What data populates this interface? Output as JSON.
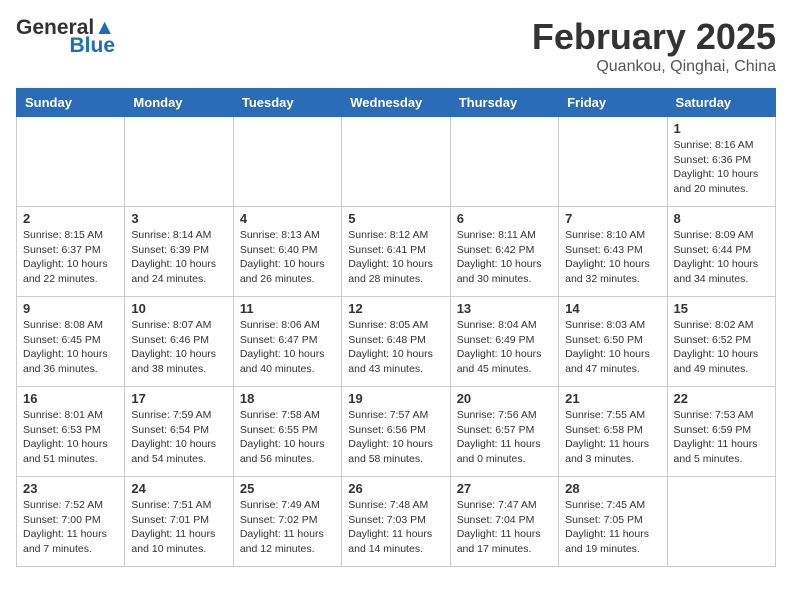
{
  "header": {
    "logo_general": "General",
    "logo_blue": "Blue",
    "month_year": "February 2025",
    "location": "Quankou, Qinghai, China"
  },
  "weekdays": [
    "Sunday",
    "Monday",
    "Tuesday",
    "Wednesday",
    "Thursday",
    "Friday",
    "Saturday"
  ],
  "weeks": [
    [
      {
        "day": "",
        "info": ""
      },
      {
        "day": "",
        "info": ""
      },
      {
        "day": "",
        "info": ""
      },
      {
        "day": "",
        "info": ""
      },
      {
        "day": "",
        "info": ""
      },
      {
        "day": "",
        "info": ""
      },
      {
        "day": "1",
        "info": "Sunrise: 8:16 AM\nSunset: 6:36 PM\nDaylight: 10 hours and 20 minutes."
      }
    ],
    [
      {
        "day": "2",
        "info": "Sunrise: 8:15 AM\nSunset: 6:37 PM\nDaylight: 10 hours and 22 minutes."
      },
      {
        "day": "3",
        "info": "Sunrise: 8:14 AM\nSunset: 6:39 PM\nDaylight: 10 hours and 24 minutes."
      },
      {
        "day": "4",
        "info": "Sunrise: 8:13 AM\nSunset: 6:40 PM\nDaylight: 10 hours and 26 minutes."
      },
      {
        "day": "5",
        "info": "Sunrise: 8:12 AM\nSunset: 6:41 PM\nDaylight: 10 hours and 28 minutes."
      },
      {
        "day": "6",
        "info": "Sunrise: 8:11 AM\nSunset: 6:42 PM\nDaylight: 10 hours and 30 minutes."
      },
      {
        "day": "7",
        "info": "Sunrise: 8:10 AM\nSunset: 6:43 PM\nDaylight: 10 hours and 32 minutes."
      },
      {
        "day": "8",
        "info": "Sunrise: 8:09 AM\nSunset: 6:44 PM\nDaylight: 10 hours and 34 minutes."
      }
    ],
    [
      {
        "day": "9",
        "info": "Sunrise: 8:08 AM\nSunset: 6:45 PM\nDaylight: 10 hours and 36 minutes."
      },
      {
        "day": "10",
        "info": "Sunrise: 8:07 AM\nSunset: 6:46 PM\nDaylight: 10 hours and 38 minutes."
      },
      {
        "day": "11",
        "info": "Sunrise: 8:06 AM\nSunset: 6:47 PM\nDaylight: 10 hours and 40 minutes."
      },
      {
        "day": "12",
        "info": "Sunrise: 8:05 AM\nSunset: 6:48 PM\nDaylight: 10 hours and 43 minutes."
      },
      {
        "day": "13",
        "info": "Sunrise: 8:04 AM\nSunset: 6:49 PM\nDaylight: 10 hours and 45 minutes."
      },
      {
        "day": "14",
        "info": "Sunrise: 8:03 AM\nSunset: 6:50 PM\nDaylight: 10 hours and 47 minutes."
      },
      {
        "day": "15",
        "info": "Sunrise: 8:02 AM\nSunset: 6:52 PM\nDaylight: 10 hours and 49 minutes."
      }
    ],
    [
      {
        "day": "16",
        "info": "Sunrise: 8:01 AM\nSunset: 6:53 PM\nDaylight: 10 hours and 51 minutes."
      },
      {
        "day": "17",
        "info": "Sunrise: 7:59 AM\nSunset: 6:54 PM\nDaylight: 10 hours and 54 minutes."
      },
      {
        "day": "18",
        "info": "Sunrise: 7:58 AM\nSunset: 6:55 PM\nDaylight: 10 hours and 56 minutes."
      },
      {
        "day": "19",
        "info": "Sunrise: 7:57 AM\nSunset: 6:56 PM\nDaylight: 10 hours and 58 minutes."
      },
      {
        "day": "20",
        "info": "Sunrise: 7:56 AM\nSunset: 6:57 PM\nDaylight: 11 hours and 0 minutes."
      },
      {
        "day": "21",
        "info": "Sunrise: 7:55 AM\nSunset: 6:58 PM\nDaylight: 11 hours and 3 minutes."
      },
      {
        "day": "22",
        "info": "Sunrise: 7:53 AM\nSunset: 6:59 PM\nDaylight: 11 hours and 5 minutes."
      }
    ],
    [
      {
        "day": "23",
        "info": "Sunrise: 7:52 AM\nSunset: 7:00 PM\nDaylight: 11 hours and 7 minutes."
      },
      {
        "day": "24",
        "info": "Sunrise: 7:51 AM\nSunset: 7:01 PM\nDaylight: 11 hours and 10 minutes."
      },
      {
        "day": "25",
        "info": "Sunrise: 7:49 AM\nSunset: 7:02 PM\nDaylight: 11 hours and 12 minutes."
      },
      {
        "day": "26",
        "info": "Sunrise: 7:48 AM\nSunset: 7:03 PM\nDaylight: 11 hours and 14 minutes."
      },
      {
        "day": "27",
        "info": "Sunrise: 7:47 AM\nSunset: 7:04 PM\nDaylight: 11 hours and 17 minutes."
      },
      {
        "day": "28",
        "info": "Sunrise: 7:45 AM\nSunset: 7:05 PM\nDaylight: 11 hours and 19 minutes."
      },
      {
        "day": "",
        "info": ""
      }
    ]
  ]
}
